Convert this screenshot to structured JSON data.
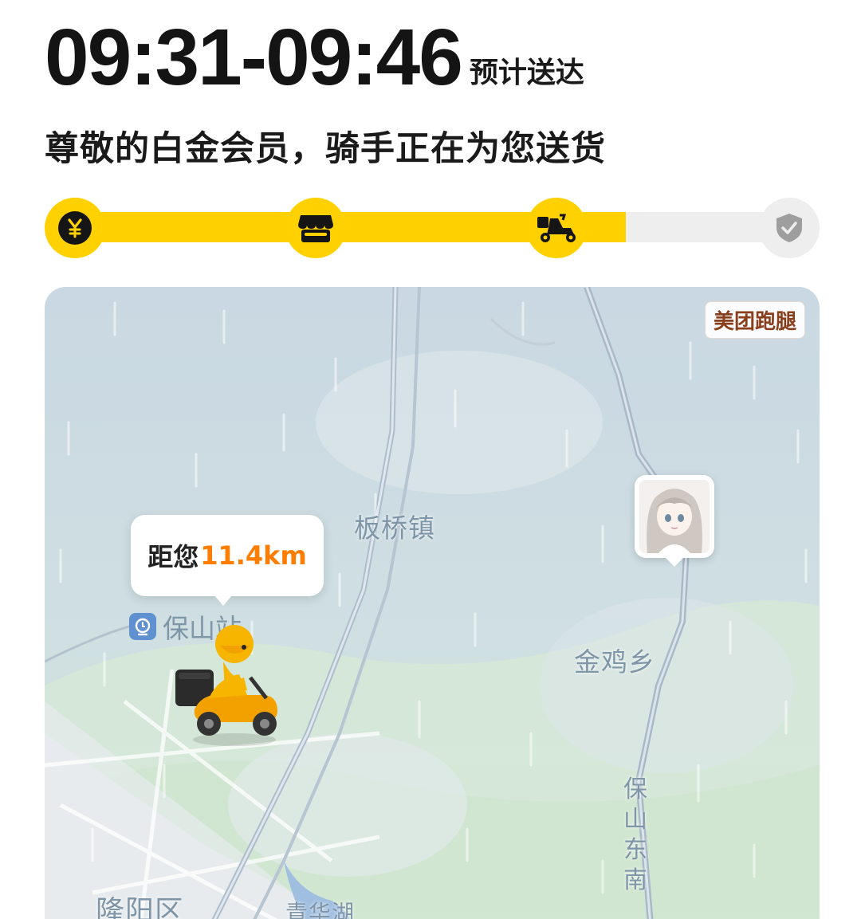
{
  "header": {
    "eta_time": "09:31-09:46",
    "eta_label": "预计送达",
    "status_message": "尊敬的白金会员，骑手正在为您送货"
  },
  "progress": {
    "fill_fraction": 0.755,
    "steps": [
      {
        "icon": "yen-icon",
        "state": "done"
      },
      {
        "icon": "store-icon",
        "state": "done"
      },
      {
        "icon": "rider-scooter-icon",
        "state": "done"
      },
      {
        "icon": "check-shield-icon",
        "state": "todo"
      }
    ]
  },
  "map": {
    "provider_badge": "美团跑腿",
    "distance_prefix": "距您",
    "distance_value": "11.4km",
    "places": {
      "banqiao": "板桥镇",
      "jinji": "金鸡乡",
      "longyang": "隆阳区",
      "qinghua": "青华湖",
      "road": "保山东南",
      "station": "保山站"
    }
  },
  "colors": {
    "accent_yellow": "#ffd100",
    "distance_orange": "#ff7d00",
    "badge_text": "#8a3f1c"
  }
}
